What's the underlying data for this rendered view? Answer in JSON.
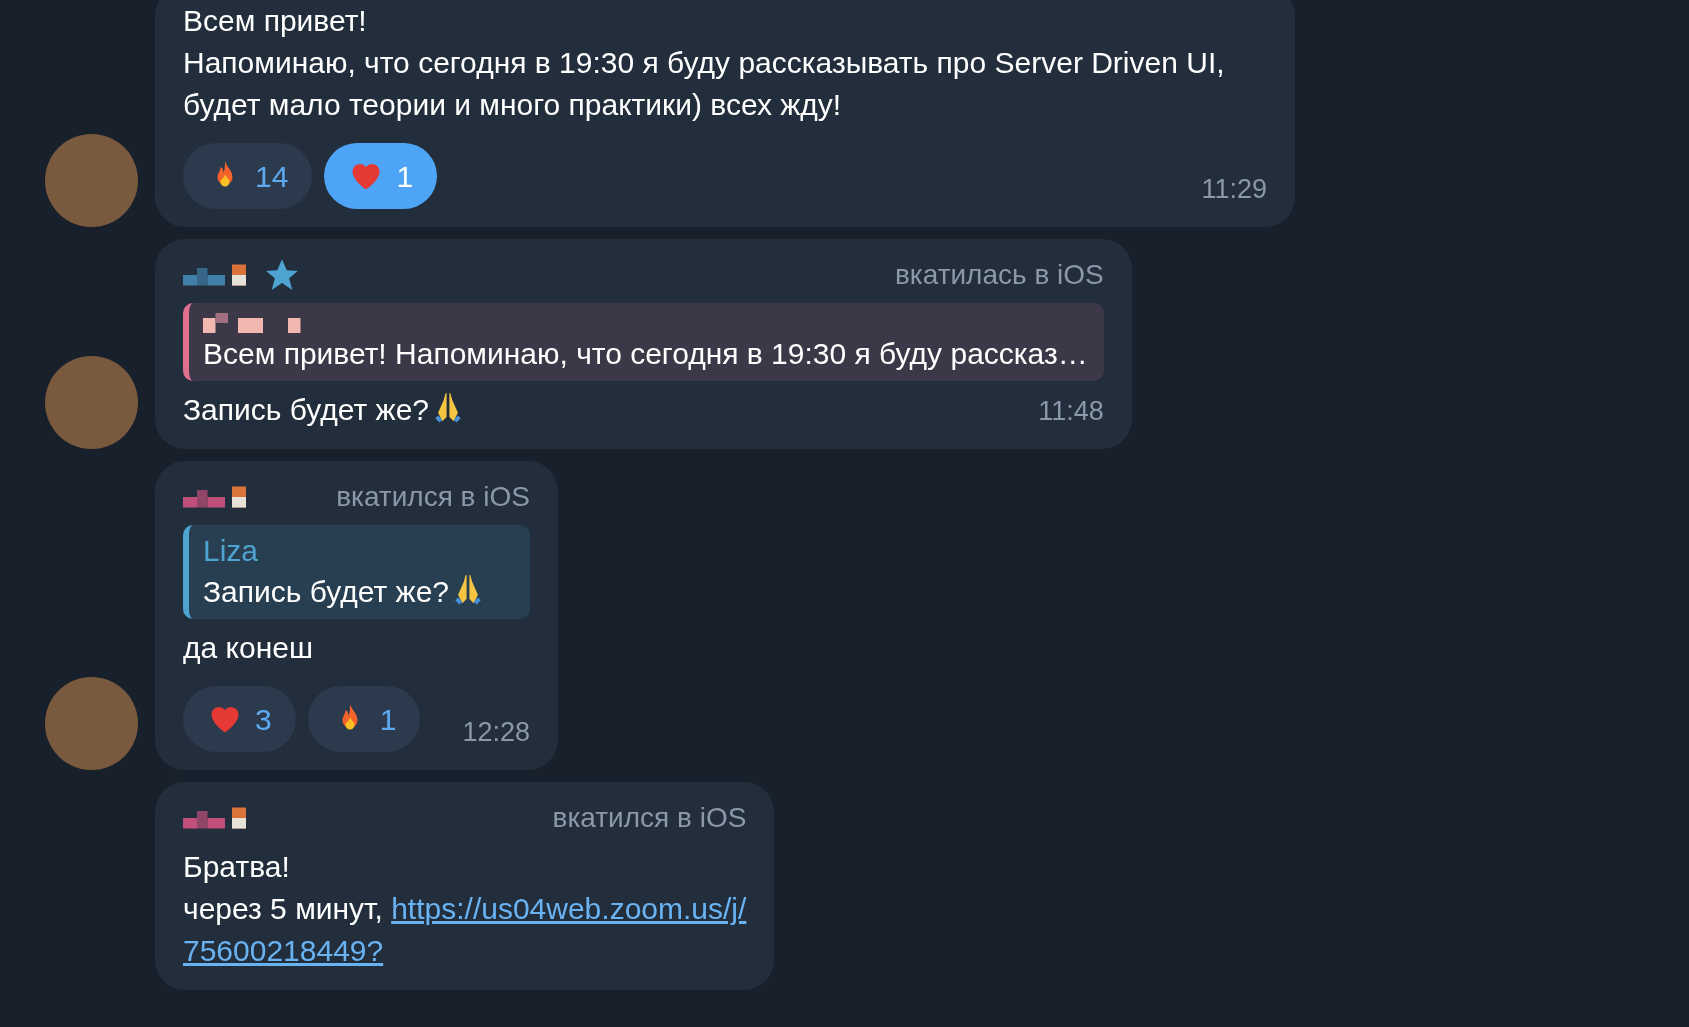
{
  "messages": [
    {
      "avatar": true,
      "paragraphs": [
        [
          {
            "text": "Всем привет!"
          }
        ],
        [
          {
            "text": "Напоминаю, что сегодня в 19:30 я буду рассказывать про Server Driven UI, будет мало теории и много практики) всех жду!"
          }
        ]
      ],
      "reactions": [
        {
          "kind": "fire",
          "count": "14",
          "selected": false
        },
        {
          "kind": "heart",
          "count": "1",
          "selected": true
        }
      ],
      "time": "11:29"
    },
    {
      "avatar": true,
      "header": {
        "color": "#3f7fa8",
        "star": true,
        "tag": "вкатилась в iOS"
      },
      "reply": {
        "color": "#e0708f",
        "parts": [
          {
            "text": "Всем привет! Напоминаю, что сегодня в 19:30 я буду рассказ…"
          }
        ]
      },
      "paragraphs": [
        [
          {
            "text": "Запись будет же?"
          },
          {
            "kind": "pray"
          }
        ]
      ],
      "time": "11:48"
    },
    {
      "avatar": true,
      "header": {
        "color": "#c0507a",
        "star": false,
        "tag": "вкатился в iOS"
      },
      "reply": {
        "color": "#4fa3d1",
        "author": "Liza",
        "parts": [
          {
            "text": "Запись будет же?"
          },
          {
            "kind": "pray"
          }
        ]
      },
      "paragraphs": [
        [
          {
            "text": "да конеш"
          }
        ]
      ],
      "reactions": [
        {
          "kind": "heart",
          "count": "3",
          "selected": false
        },
        {
          "kind": "fire",
          "count": "1",
          "selected": false
        }
      ],
      "time": "12:28"
    },
    {
      "avatar": false,
      "header": {
        "color": "#c0507a",
        "star": false,
        "tag": "вкатился в iOS"
      },
      "paragraphs": [
        [
          {
            "text": "Братва!"
          }
        ],
        [
          {
            "text": "через 5 минут, "
          },
          {
            "link": "https://us04web.zoom.us/j/"
          }
        ],
        [
          {
            "link": "75600218449?"
          }
        ]
      ]
    }
  ]
}
